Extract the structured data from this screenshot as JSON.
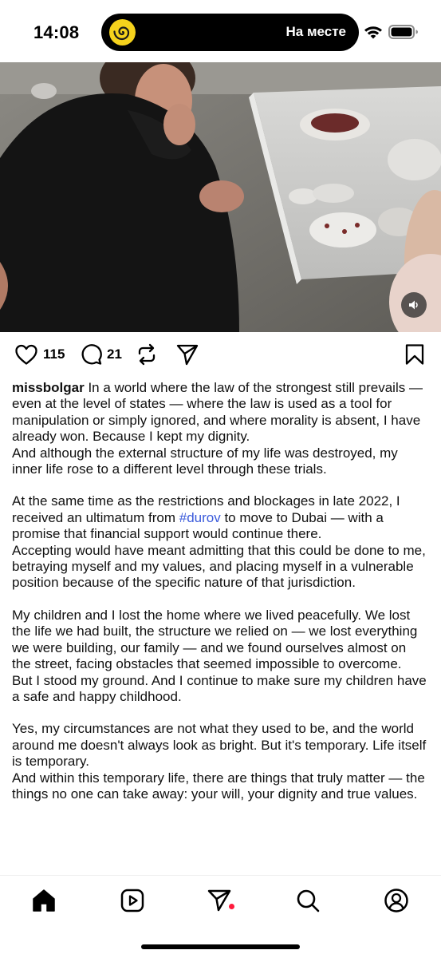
{
  "status_bar": {
    "time": "14:08",
    "activity_text": "На месте",
    "activity_icon": "spiral-app-icon",
    "accent_color": "#f5d21c"
  },
  "post": {
    "media_type": "video",
    "volume_icon": "speaker-icon",
    "actions": {
      "like_count": "115",
      "comment_count": "21"
    },
    "caption": {
      "username": "missbolgar",
      "p1": "In a world where the law of the strongest still prevails — even at the level of states — where the law is used as a tool for manipulation or simply ignored, and where morality is absent, I have already won. Because I kept my dignity.",
      "p2": "And although the external structure of my life was destroyed, my inner life rose to a different level through these trials.",
      "p3_before": "At the same time as the restrictions and blockages in late 2022, I received an ultimatum from ",
      "p3_hashtag": "#durov",
      "p3_after": " to move to Dubai — with a promise that financial support would continue there.",
      "p4": "Accepting would have meant admitting that this could be done to me, betraying myself and my values, and placing myself in a vulnerable position because of the specific nature of that jurisdiction.",
      "p5": "My children and I lost the home where we lived peacefully. We lost the life we had built, the structure we relied on — we lost everything we were building, our family — and we found ourselves almost on the street, facing obstacles that seemed impossible to overcome.",
      "p6": "But I stood my ground. And I continue to make sure my children have a safe and happy childhood.",
      "p7": "Yes, my circumstances are not what they used to be, and the world around me doesn't always look as bright. But it's temporary. Life itself is temporary.",
      "p8": "And within this temporary life, there are things that truly matter — the things no one can take away: your will, your dignity and true values."
    }
  },
  "bottom_nav": {
    "items": [
      "home-icon",
      "reels-icon",
      "direct-icon",
      "search-icon",
      "profile-icon"
    ],
    "notification_color": "#ff1a3c"
  }
}
